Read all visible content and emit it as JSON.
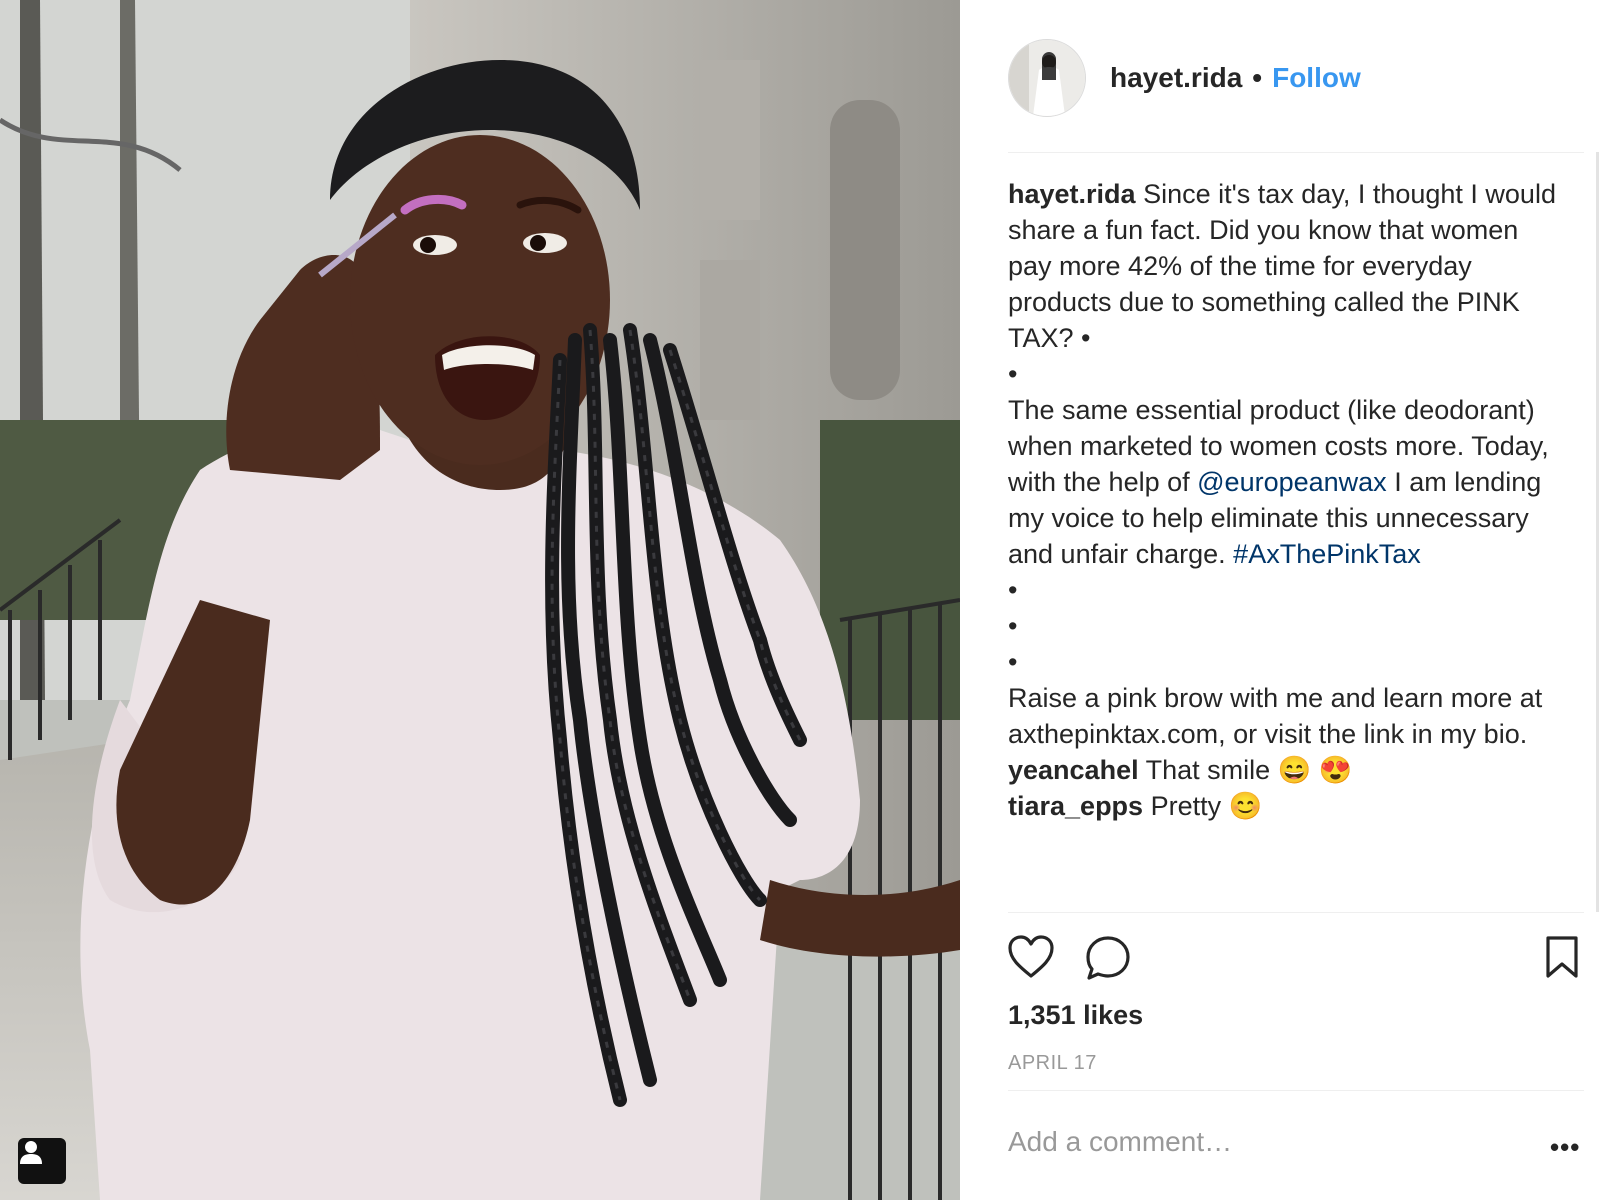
{
  "post": {
    "username": "hayet.rida",
    "separator": "•",
    "follow_label": "Follow",
    "likes": "1,351 likes",
    "date": "APRIL 17"
  },
  "caption": {
    "username": "hayet.rida",
    "line1": "Since it's tax day, I thought I would share a fun fact. Did you know that women pay more 42% of the time for everyday products due to something called the PINK TAX? •",
    "bullet": "•",
    "line2": "The same essential product (like deodorant) when marketed to women costs more. Today, with the help of",
    "mention": "@europeanwax",
    "line3": "I am lending my voice to help eliminate this unnecessary and unfair charge.",
    "hashtag": "#AxThePinkTax",
    "line4": "Raise a pink brow with me and learn more at axthepinktax.com, or visit the link in my bio."
  },
  "comments": [
    {
      "username": "yeancahel",
      "text": "That smile",
      "emoji": "😄 😍"
    },
    {
      "username": "tiara_epps",
      "text": "Pretty",
      "emoji": "😊"
    }
  ],
  "comment_input": {
    "placeholder": "Add a comment…"
  },
  "more_label": "•••",
  "icons": {
    "like": "heart-icon",
    "comment": "speech-bubble-icon",
    "save": "bookmark-icon",
    "user_tag": "person-icon"
  },
  "colors": {
    "link": "#3897f0",
    "mention": "#003569",
    "muted": "#999999",
    "text": "#262626"
  }
}
